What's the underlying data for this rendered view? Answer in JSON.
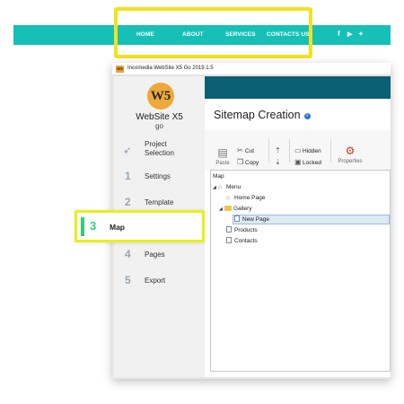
{
  "website_nav": {
    "links": [
      "HOME",
      "ABOUT",
      "SERVICES",
      "CONTACTS US"
    ],
    "social_icons": [
      "facebook-icon",
      "youtube-icon",
      "twitter-icon"
    ],
    "bar_color": "#16c0b6",
    "highlight_color": "#f2e21c"
  },
  "app": {
    "window_title": "Incomedia WebSite X5 Go 2019.1.5",
    "logo_text": "W5",
    "brand_line1": "WebSite X5",
    "brand_line2": "go",
    "steps": [
      {
        "number": "",
        "label": "Project\nSelection"
      },
      {
        "number": "1",
        "label": "Settings"
      },
      {
        "number": "2",
        "label": "Template"
      },
      {
        "number": "3",
        "label": "Map"
      },
      {
        "number": "4",
        "label": "Pages"
      },
      {
        "number": "5",
        "label": "Export"
      }
    ],
    "active_step_color": "#2fcf78",
    "header_color": "#0b5f73"
  },
  "sitemap": {
    "title": "Sitemap Creation",
    "toolbar": {
      "paste": "Paste",
      "cut": "Cut",
      "copy": "Copy",
      "hidden": "Hidden",
      "locked": "Locked",
      "properties": "Properties"
    },
    "tree": {
      "root": "Map",
      "menu": "Menu",
      "home": "Home Page",
      "gallery": "Gallery",
      "new_page": "New Page",
      "products": "Products",
      "contacts": "Contacts"
    },
    "selected_item": "New Page"
  }
}
